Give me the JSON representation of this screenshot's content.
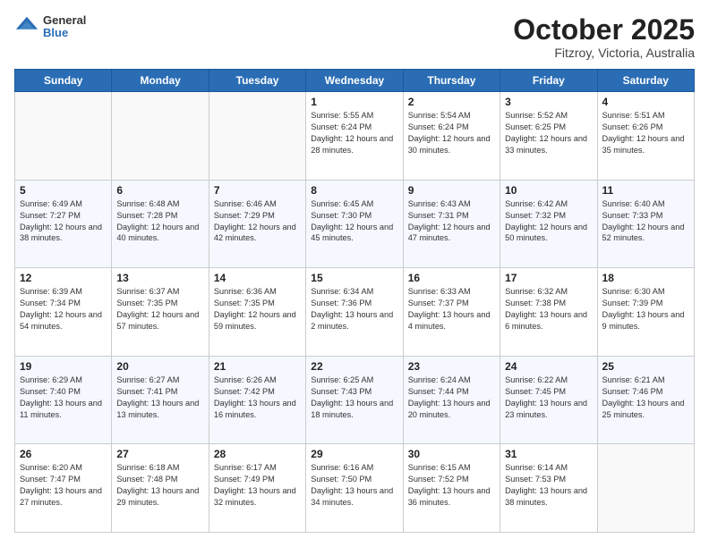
{
  "header": {
    "logo_general": "General",
    "logo_blue": "Blue",
    "month_title": "October 2025",
    "subtitle": "Fitzroy, Victoria, Australia"
  },
  "weekdays": [
    "Sunday",
    "Monday",
    "Tuesday",
    "Wednesday",
    "Thursday",
    "Friday",
    "Saturday"
  ],
  "weeks": [
    [
      {
        "day": "",
        "sunrise": "",
        "sunset": "",
        "daylight": ""
      },
      {
        "day": "",
        "sunrise": "",
        "sunset": "",
        "daylight": ""
      },
      {
        "day": "",
        "sunrise": "",
        "sunset": "",
        "daylight": ""
      },
      {
        "day": "1",
        "sunrise": "Sunrise: 5:55 AM",
        "sunset": "Sunset: 6:24 PM",
        "daylight": "Daylight: 12 hours and 28 minutes."
      },
      {
        "day": "2",
        "sunrise": "Sunrise: 5:54 AM",
        "sunset": "Sunset: 6:24 PM",
        "daylight": "Daylight: 12 hours and 30 minutes."
      },
      {
        "day": "3",
        "sunrise": "Sunrise: 5:52 AM",
        "sunset": "Sunset: 6:25 PM",
        "daylight": "Daylight: 12 hours and 33 minutes."
      },
      {
        "day": "4",
        "sunrise": "Sunrise: 5:51 AM",
        "sunset": "Sunset: 6:26 PM",
        "daylight": "Daylight: 12 hours and 35 minutes."
      }
    ],
    [
      {
        "day": "5",
        "sunrise": "Sunrise: 6:49 AM",
        "sunset": "Sunset: 7:27 PM",
        "daylight": "Daylight: 12 hours and 38 minutes."
      },
      {
        "day": "6",
        "sunrise": "Sunrise: 6:48 AM",
        "sunset": "Sunset: 7:28 PM",
        "daylight": "Daylight: 12 hours and 40 minutes."
      },
      {
        "day": "7",
        "sunrise": "Sunrise: 6:46 AM",
        "sunset": "Sunset: 7:29 PM",
        "daylight": "Daylight: 12 hours and 42 minutes."
      },
      {
        "day": "8",
        "sunrise": "Sunrise: 6:45 AM",
        "sunset": "Sunset: 7:30 PM",
        "daylight": "Daylight: 12 hours and 45 minutes."
      },
      {
        "day": "9",
        "sunrise": "Sunrise: 6:43 AM",
        "sunset": "Sunset: 7:31 PM",
        "daylight": "Daylight: 12 hours and 47 minutes."
      },
      {
        "day": "10",
        "sunrise": "Sunrise: 6:42 AM",
        "sunset": "Sunset: 7:32 PM",
        "daylight": "Daylight: 12 hours and 50 minutes."
      },
      {
        "day": "11",
        "sunrise": "Sunrise: 6:40 AM",
        "sunset": "Sunset: 7:33 PM",
        "daylight": "Daylight: 12 hours and 52 minutes."
      }
    ],
    [
      {
        "day": "12",
        "sunrise": "Sunrise: 6:39 AM",
        "sunset": "Sunset: 7:34 PM",
        "daylight": "Daylight: 12 hours and 54 minutes."
      },
      {
        "day": "13",
        "sunrise": "Sunrise: 6:37 AM",
        "sunset": "Sunset: 7:35 PM",
        "daylight": "Daylight: 12 hours and 57 minutes."
      },
      {
        "day": "14",
        "sunrise": "Sunrise: 6:36 AM",
        "sunset": "Sunset: 7:35 PM",
        "daylight": "Daylight: 12 hours and 59 minutes."
      },
      {
        "day": "15",
        "sunrise": "Sunrise: 6:34 AM",
        "sunset": "Sunset: 7:36 PM",
        "daylight": "Daylight: 13 hours and 2 minutes."
      },
      {
        "day": "16",
        "sunrise": "Sunrise: 6:33 AM",
        "sunset": "Sunset: 7:37 PM",
        "daylight": "Daylight: 13 hours and 4 minutes."
      },
      {
        "day": "17",
        "sunrise": "Sunrise: 6:32 AM",
        "sunset": "Sunset: 7:38 PM",
        "daylight": "Daylight: 13 hours and 6 minutes."
      },
      {
        "day": "18",
        "sunrise": "Sunrise: 6:30 AM",
        "sunset": "Sunset: 7:39 PM",
        "daylight": "Daylight: 13 hours and 9 minutes."
      }
    ],
    [
      {
        "day": "19",
        "sunrise": "Sunrise: 6:29 AM",
        "sunset": "Sunset: 7:40 PM",
        "daylight": "Daylight: 13 hours and 11 minutes."
      },
      {
        "day": "20",
        "sunrise": "Sunrise: 6:27 AM",
        "sunset": "Sunset: 7:41 PM",
        "daylight": "Daylight: 13 hours and 13 minutes."
      },
      {
        "day": "21",
        "sunrise": "Sunrise: 6:26 AM",
        "sunset": "Sunset: 7:42 PM",
        "daylight": "Daylight: 13 hours and 16 minutes."
      },
      {
        "day": "22",
        "sunrise": "Sunrise: 6:25 AM",
        "sunset": "Sunset: 7:43 PM",
        "daylight": "Daylight: 13 hours and 18 minutes."
      },
      {
        "day": "23",
        "sunrise": "Sunrise: 6:24 AM",
        "sunset": "Sunset: 7:44 PM",
        "daylight": "Daylight: 13 hours and 20 minutes."
      },
      {
        "day": "24",
        "sunrise": "Sunrise: 6:22 AM",
        "sunset": "Sunset: 7:45 PM",
        "daylight": "Daylight: 13 hours and 23 minutes."
      },
      {
        "day": "25",
        "sunrise": "Sunrise: 6:21 AM",
        "sunset": "Sunset: 7:46 PM",
        "daylight": "Daylight: 13 hours and 25 minutes."
      }
    ],
    [
      {
        "day": "26",
        "sunrise": "Sunrise: 6:20 AM",
        "sunset": "Sunset: 7:47 PM",
        "daylight": "Daylight: 13 hours and 27 minutes."
      },
      {
        "day": "27",
        "sunrise": "Sunrise: 6:18 AM",
        "sunset": "Sunset: 7:48 PM",
        "daylight": "Daylight: 13 hours and 29 minutes."
      },
      {
        "day": "28",
        "sunrise": "Sunrise: 6:17 AM",
        "sunset": "Sunset: 7:49 PM",
        "daylight": "Daylight: 13 hours and 32 minutes."
      },
      {
        "day": "29",
        "sunrise": "Sunrise: 6:16 AM",
        "sunset": "Sunset: 7:50 PM",
        "daylight": "Daylight: 13 hours and 34 minutes."
      },
      {
        "day": "30",
        "sunrise": "Sunrise: 6:15 AM",
        "sunset": "Sunset: 7:52 PM",
        "daylight": "Daylight: 13 hours and 36 minutes."
      },
      {
        "day": "31",
        "sunrise": "Sunrise: 6:14 AM",
        "sunset": "Sunset: 7:53 PM",
        "daylight": "Daylight: 13 hours and 38 minutes."
      },
      {
        "day": "",
        "sunrise": "",
        "sunset": "",
        "daylight": ""
      }
    ]
  ]
}
